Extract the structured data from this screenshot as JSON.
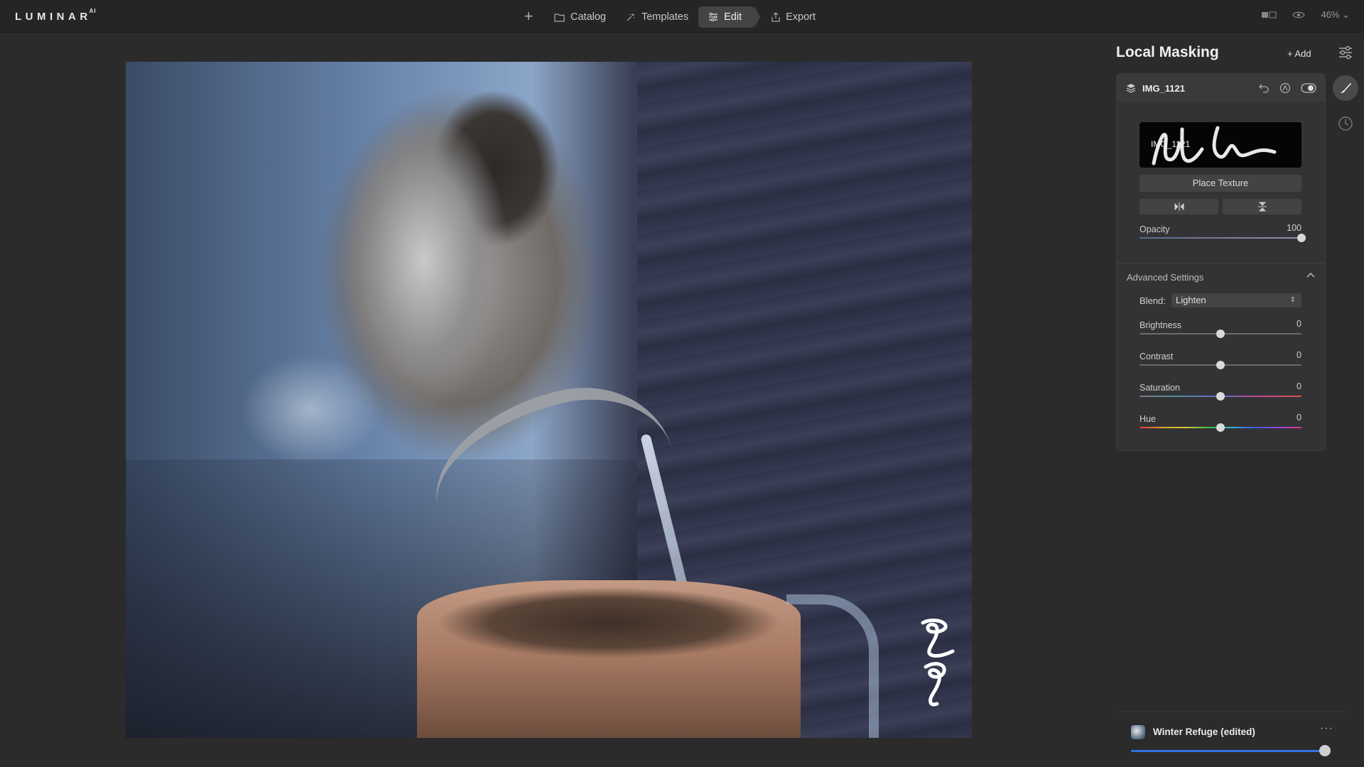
{
  "app": {
    "logo_text": "LUMINAR",
    "logo_suffix": "AI"
  },
  "nav": {
    "add_icon": "plus-icon",
    "items": [
      {
        "label": "Catalog",
        "icon": "folder-icon"
      },
      {
        "label": "Templates",
        "icon": "sparkle-icon"
      },
      {
        "label": "Edit",
        "icon": "sliders-icon",
        "active": true
      },
      {
        "label": "Export",
        "icon": "share-icon"
      }
    ]
  },
  "top_right": {
    "zoom": "46%",
    "compare_icon": "compare-icon",
    "preview_icon": "eye-icon"
  },
  "panel": {
    "title": "Local Masking",
    "add_label": "+ Add",
    "layer": {
      "name": "IMG_1121",
      "thumb_label": "IMG_1121",
      "place_texture_label": "Place Texture",
      "opacity": {
        "label": "Opacity",
        "value": "100"
      }
    },
    "advanced": {
      "title": "Advanced Settings",
      "blend_label": "Blend:",
      "blend_value": "Lighten",
      "brightness": {
        "label": "Brightness",
        "value": "0"
      },
      "contrast": {
        "label": "Contrast",
        "value": "0"
      },
      "saturation": {
        "label": "Saturation",
        "value": "0"
      },
      "hue": {
        "label": "Hue",
        "value": "0"
      }
    }
  },
  "preset": {
    "name": "Winter Refuge (edited)",
    "more": "···",
    "amount": 1.0
  },
  "colors": {
    "accent": "#2f74e0",
    "background": "#2b2b2c",
    "panel": "#333335"
  }
}
